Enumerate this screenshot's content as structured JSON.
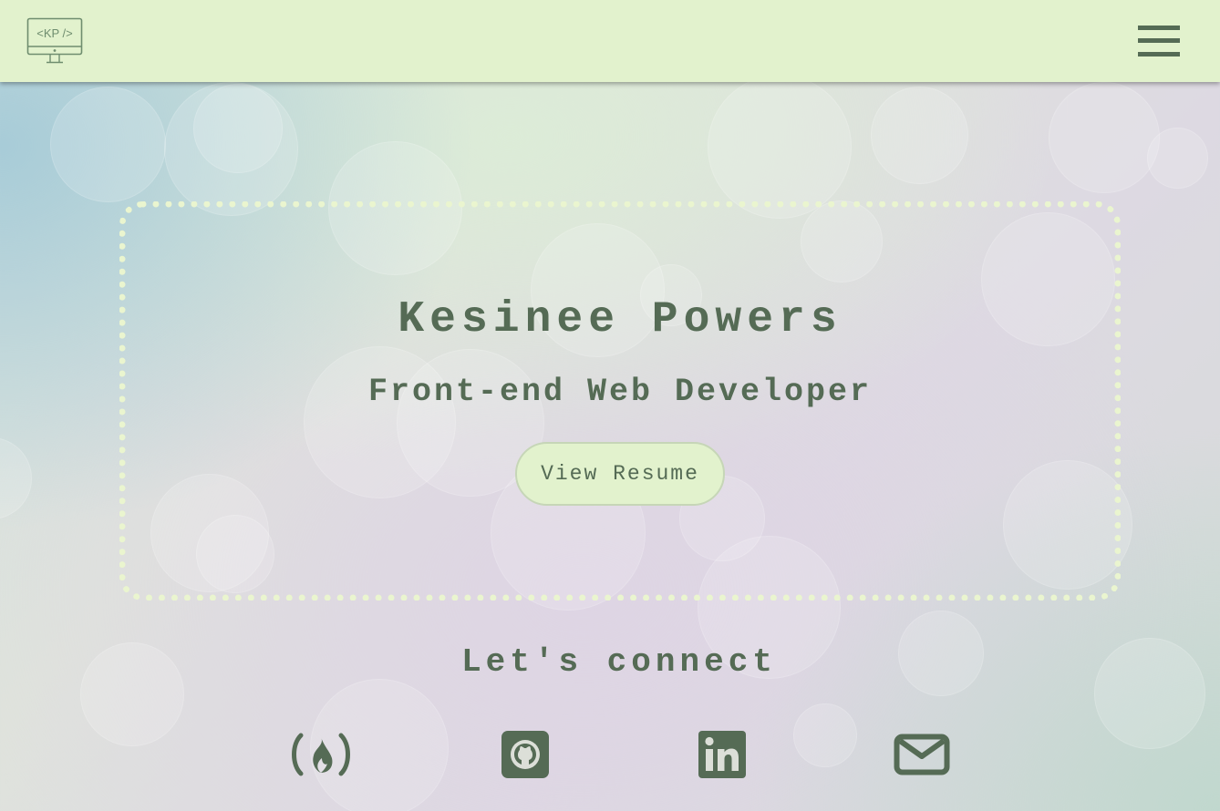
{
  "navbar": {
    "logo_text": "<KP />",
    "logo_icon": "monitor-code-icon",
    "menu_icon": "hamburger-menu-icon"
  },
  "hero": {
    "name": "Kesinee Powers",
    "role": "Front-end Web Developer",
    "resume_button": "View Resume"
  },
  "connect": {
    "title": "Let's connect",
    "links": [
      {
        "icon": "freecodecamp-icon"
      },
      {
        "icon": "github-icon"
      },
      {
        "icon": "linkedin-icon"
      },
      {
        "icon": "envelope-icon"
      }
    ]
  },
  "colors": {
    "navbar_bg": "#e2f2cd",
    "primary_text": "#556b55",
    "dotted_border": "#eaf5cf"
  }
}
